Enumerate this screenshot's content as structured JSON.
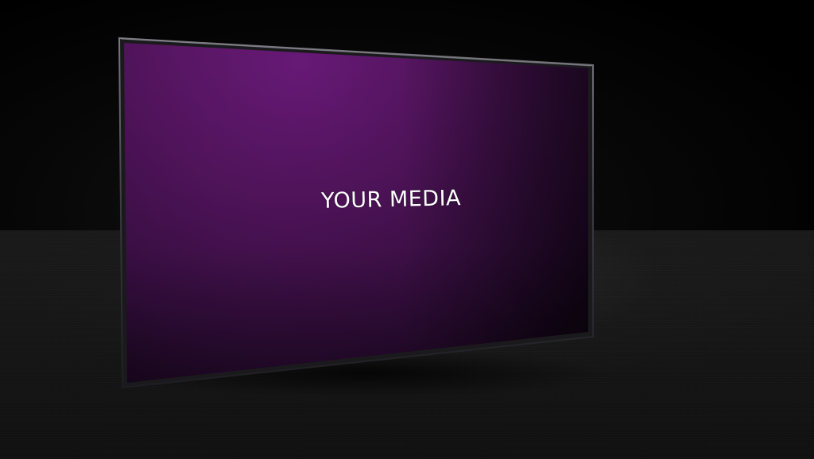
{
  "screen": {
    "label": "YOUR MEDIA",
    "primary_color": "#6a1a7a",
    "edge_color": "#1b0a22"
  }
}
